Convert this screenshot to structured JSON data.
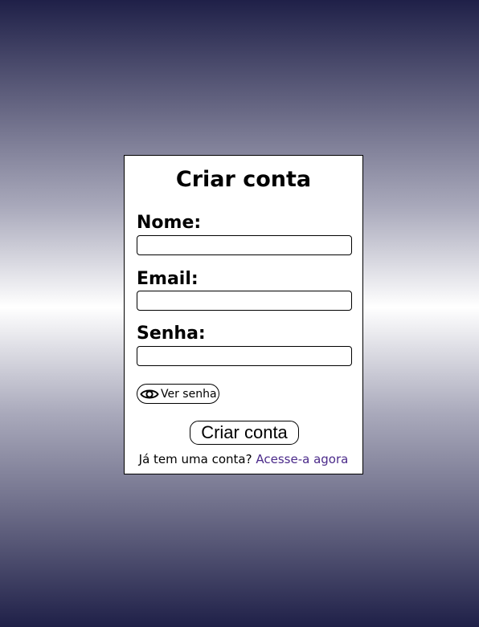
{
  "form": {
    "title": "Criar conta",
    "fields": [
      {
        "label": "Nome:",
        "value": "",
        "placeholder": ""
      },
      {
        "label": "Email:",
        "value": "",
        "placeholder": ""
      },
      {
        "label": "Senha:",
        "value": "",
        "placeholder": ""
      }
    ],
    "show_password_label": "Ver senha",
    "show_password_icon": "eye-icon",
    "submit_label": "Criar conta",
    "footer_text": "Já tem uma conta?",
    "footer_link": "Acesse-a agora"
  },
  "colors": {
    "background_dark": "#1f2048",
    "background_light": "#ffffff",
    "card_background": "#ffffff",
    "link": "#4b2a8a"
  }
}
